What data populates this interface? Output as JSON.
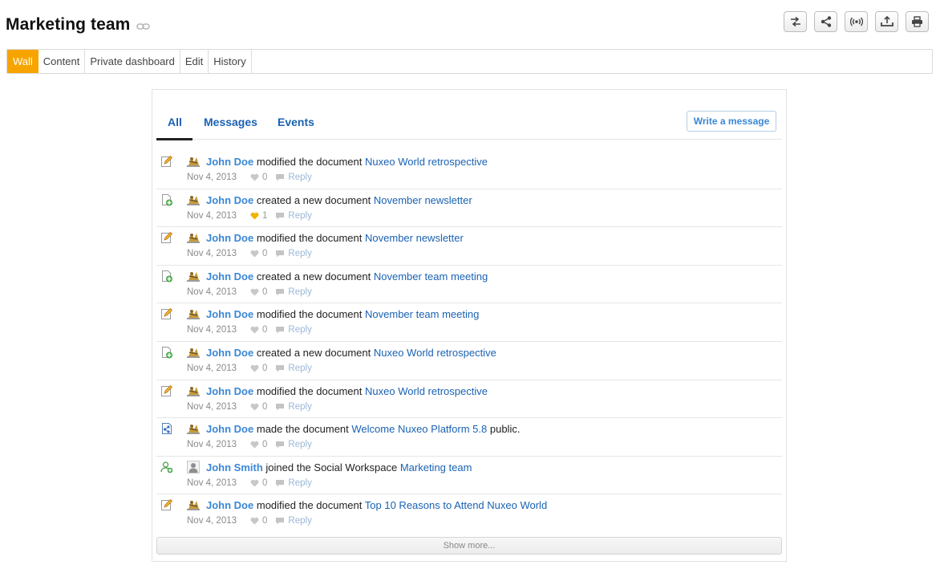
{
  "page": {
    "title": "Marketing team"
  },
  "header_actions": [
    {
      "icon": "swap-arrows-icon"
    },
    {
      "icon": "share-icon"
    },
    {
      "icon": "broadcast-icon"
    },
    {
      "icon": "upload-icon"
    },
    {
      "icon": "print-icon"
    }
  ],
  "tabs": [
    {
      "label": "Wall",
      "active": true
    },
    {
      "label": "Content"
    },
    {
      "label": "Private dashboard"
    },
    {
      "label": "Edit"
    },
    {
      "label": "History"
    }
  ],
  "wall": {
    "tabs": [
      {
        "label": "All",
        "active": true
      },
      {
        "label": "Messages"
      },
      {
        "label": "Events"
      }
    ],
    "write_button": "Write a message",
    "reply_label": "Reply",
    "show_more": "Show more...",
    "activities": [
      {
        "type_icon": "edit-pencil-icon",
        "avatar": "user-avatar-icon",
        "actor": "John Doe",
        "action": "modified the document",
        "target": "Nuxeo World retrospective",
        "suffix": "",
        "date": "Nov 4, 2013",
        "likes": "0",
        "liked": false
      },
      {
        "type_icon": "new-document-icon",
        "avatar": "user-avatar-icon",
        "actor": "John Doe",
        "action": "created a new document",
        "target": "November newsletter",
        "suffix": "",
        "date": "Nov 4, 2013",
        "likes": "1",
        "liked": true
      },
      {
        "type_icon": "edit-pencil-icon",
        "avatar": "user-avatar-icon",
        "actor": "John Doe",
        "action": "modified the document",
        "target": "November newsletter",
        "suffix": "",
        "date": "Nov 4, 2013",
        "likes": "0",
        "liked": false
      },
      {
        "type_icon": "new-document-icon",
        "avatar": "user-avatar-icon",
        "actor": "John Doe",
        "action": "created a new document",
        "target": "November team meeting",
        "suffix": "",
        "date": "Nov 4, 2013",
        "likes": "0",
        "liked": false
      },
      {
        "type_icon": "edit-pencil-icon",
        "avatar": "user-avatar-icon",
        "actor": "John Doe",
        "action": "modified the document",
        "target": "November team meeting",
        "suffix": "",
        "date": "Nov 4, 2013",
        "likes": "0",
        "liked": false
      },
      {
        "type_icon": "new-document-icon",
        "avatar": "user-avatar-icon",
        "actor": "John Doe",
        "action": "created a new document",
        "target": "Nuxeo World retrospective",
        "suffix": "",
        "date": "Nov 4, 2013",
        "likes": "0",
        "liked": false
      },
      {
        "type_icon": "edit-pencil-icon",
        "avatar": "user-avatar-icon",
        "actor": "John Doe",
        "action": "modified the document",
        "target": "Nuxeo World retrospective",
        "suffix": "",
        "date": "Nov 4, 2013",
        "likes": "0",
        "liked": false
      },
      {
        "type_icon": "share-document-icon",
        "avatar": "user-avatar-icon",
        "actor": "John Doe",
        "action": "made the document",
        "target": "Welcome Nuxeo Platform 5.8",
        "suffix": "public.",
        "date": "Nov 4, 2013",
        "likes": "0",
        "liked": false
      },
      {
        "type_icon": "add-user-icon",
        "avatar": "default-avatar-icon",
        "actor": "John Smith",
        "action": "joined the Social Workspace",
        "target": "Marketing team",
        "suffix": "",
        "date": "Nov 4, 2013",
        "likes": "0",
        "liked": false
      },
      {
        "type_icon": "edit-pencil-icon",
        "avatar": "user-avatar-icon",
        "actor": "John Doe",
        "action": "modified the document",
        "target": "Top 10 Reasons to Attend Nuxeo World",
        "suffix": "",
        "date": "Nov 4, 2013",
        "likes": "0",
        "liked": false
      }
    ]
  },
  "colors": {
    "accent_tab": "#f7a400",
    "link": "#1a62b3",
    "actor": "#3a87d6",
    "liked_heart": "#f0b400",
    "heart": "#c8c8c8"
  }
}
